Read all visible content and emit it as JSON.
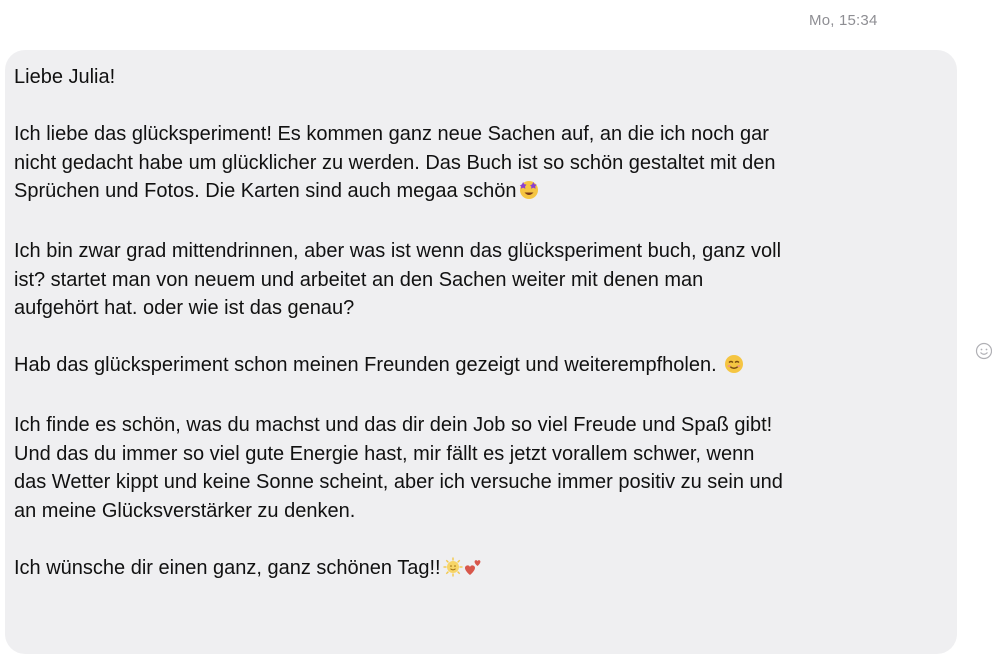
{
  "message": {
    "timestamp": "Mo, 15:34",
    "paragraphs": [
      {
        "lines": [
          "Liebe Julia!"
        ]
      },
      {
        "lines": [
          "Ich liebe das glücksperiment! Es kommen ganz neue Sachen auf, an die ich noch gar",
          "nicht gedacht habe um glücklicher zu werden. Das Buch ist so schön gestaltet mit den",
          "Sprüchen und Fotos. Die Karten sind auch megaa schön"
        ],
        "emoji": [
          "star-struck-emoji"
        ]
      },
      {
        "lines": [
          "Ich bin zwar grad mittendrinnen, aber was ist wenn das glücksperiment buch, ganz voll",
          "ist? startet man von neuem und arbeitet an den Sachen weiter mit denen man",
          "aufgehört hat. oder wie ist das genau?"
        ]
      },
      {
        "lines": [
          "Hab das glücksperiment schon meinen Freunden gezeigt und weiterempfholen. "
        ],
        "emoji": [
          "smiling-face-emoji"
        ]
      },
      {
        "lines": [
          "Ich finde es schön, was du machst und das dir dein Job so viel Freude und Spaß gibt!",
          "Und das du immer so viel gute Energie hast, mir fällt es jetzt vorallem schwer, wenn",
          "das Wetter kippt und keine Sonne scheint, aber ich versuche immer positiv zu sein und",
          "an meine Glücksverstärker zu denken."
        ]
      },
      {
        "lines": [
          "Ich wünsche dir einen ganz, ganz schönen Tag!!"
        ],
        "emoji": [
          "sun-with-face-emoji",
          "two-hearts-emoji"
        ]
      }
    ]
  },
  "react_icon": "smiley-react-icon",
  "colors": {
    "bubble": "#efeff1",
    "text": "#111111",
    "timestamp": "#8e8e93"
  }
}
